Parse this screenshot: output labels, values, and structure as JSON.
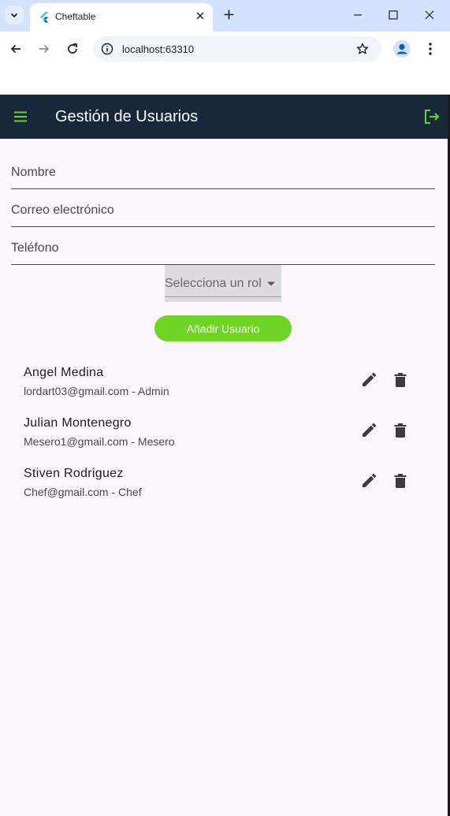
{
  "browser": {
    "tab_title": "Cheftable",
    "url": "localhost:63310"
  },
  "appbar": {
    "title": "Gestión de Usuarios"
  },
  "form": {
    "name_label": "Nombre",
    "email_label": "Correo electrónico",
    "phone_label": "Teléfono",
    "role_placeholder": "Selecciona un rol",
    "add_button": "Añadir Usuario"
  },
  "users": [
    {
      "name": "Angel Medina",
      "detail": "lordart03@gmail.com - Admin"
    },
    {
      "name": "Julian Montenegro",
      "detail": "Mesero1@gmail.com - Mesero"
    },
    {
      "name": "Stiven Rodriguez",
      "detail": "Chef@gmail.com - Chef"
    }
  ],
  "colors": {
    "appbar": "#16283a",
    "accent_green": "#6fd524",
    "page_background": "#fdf6fe"
  }
}
